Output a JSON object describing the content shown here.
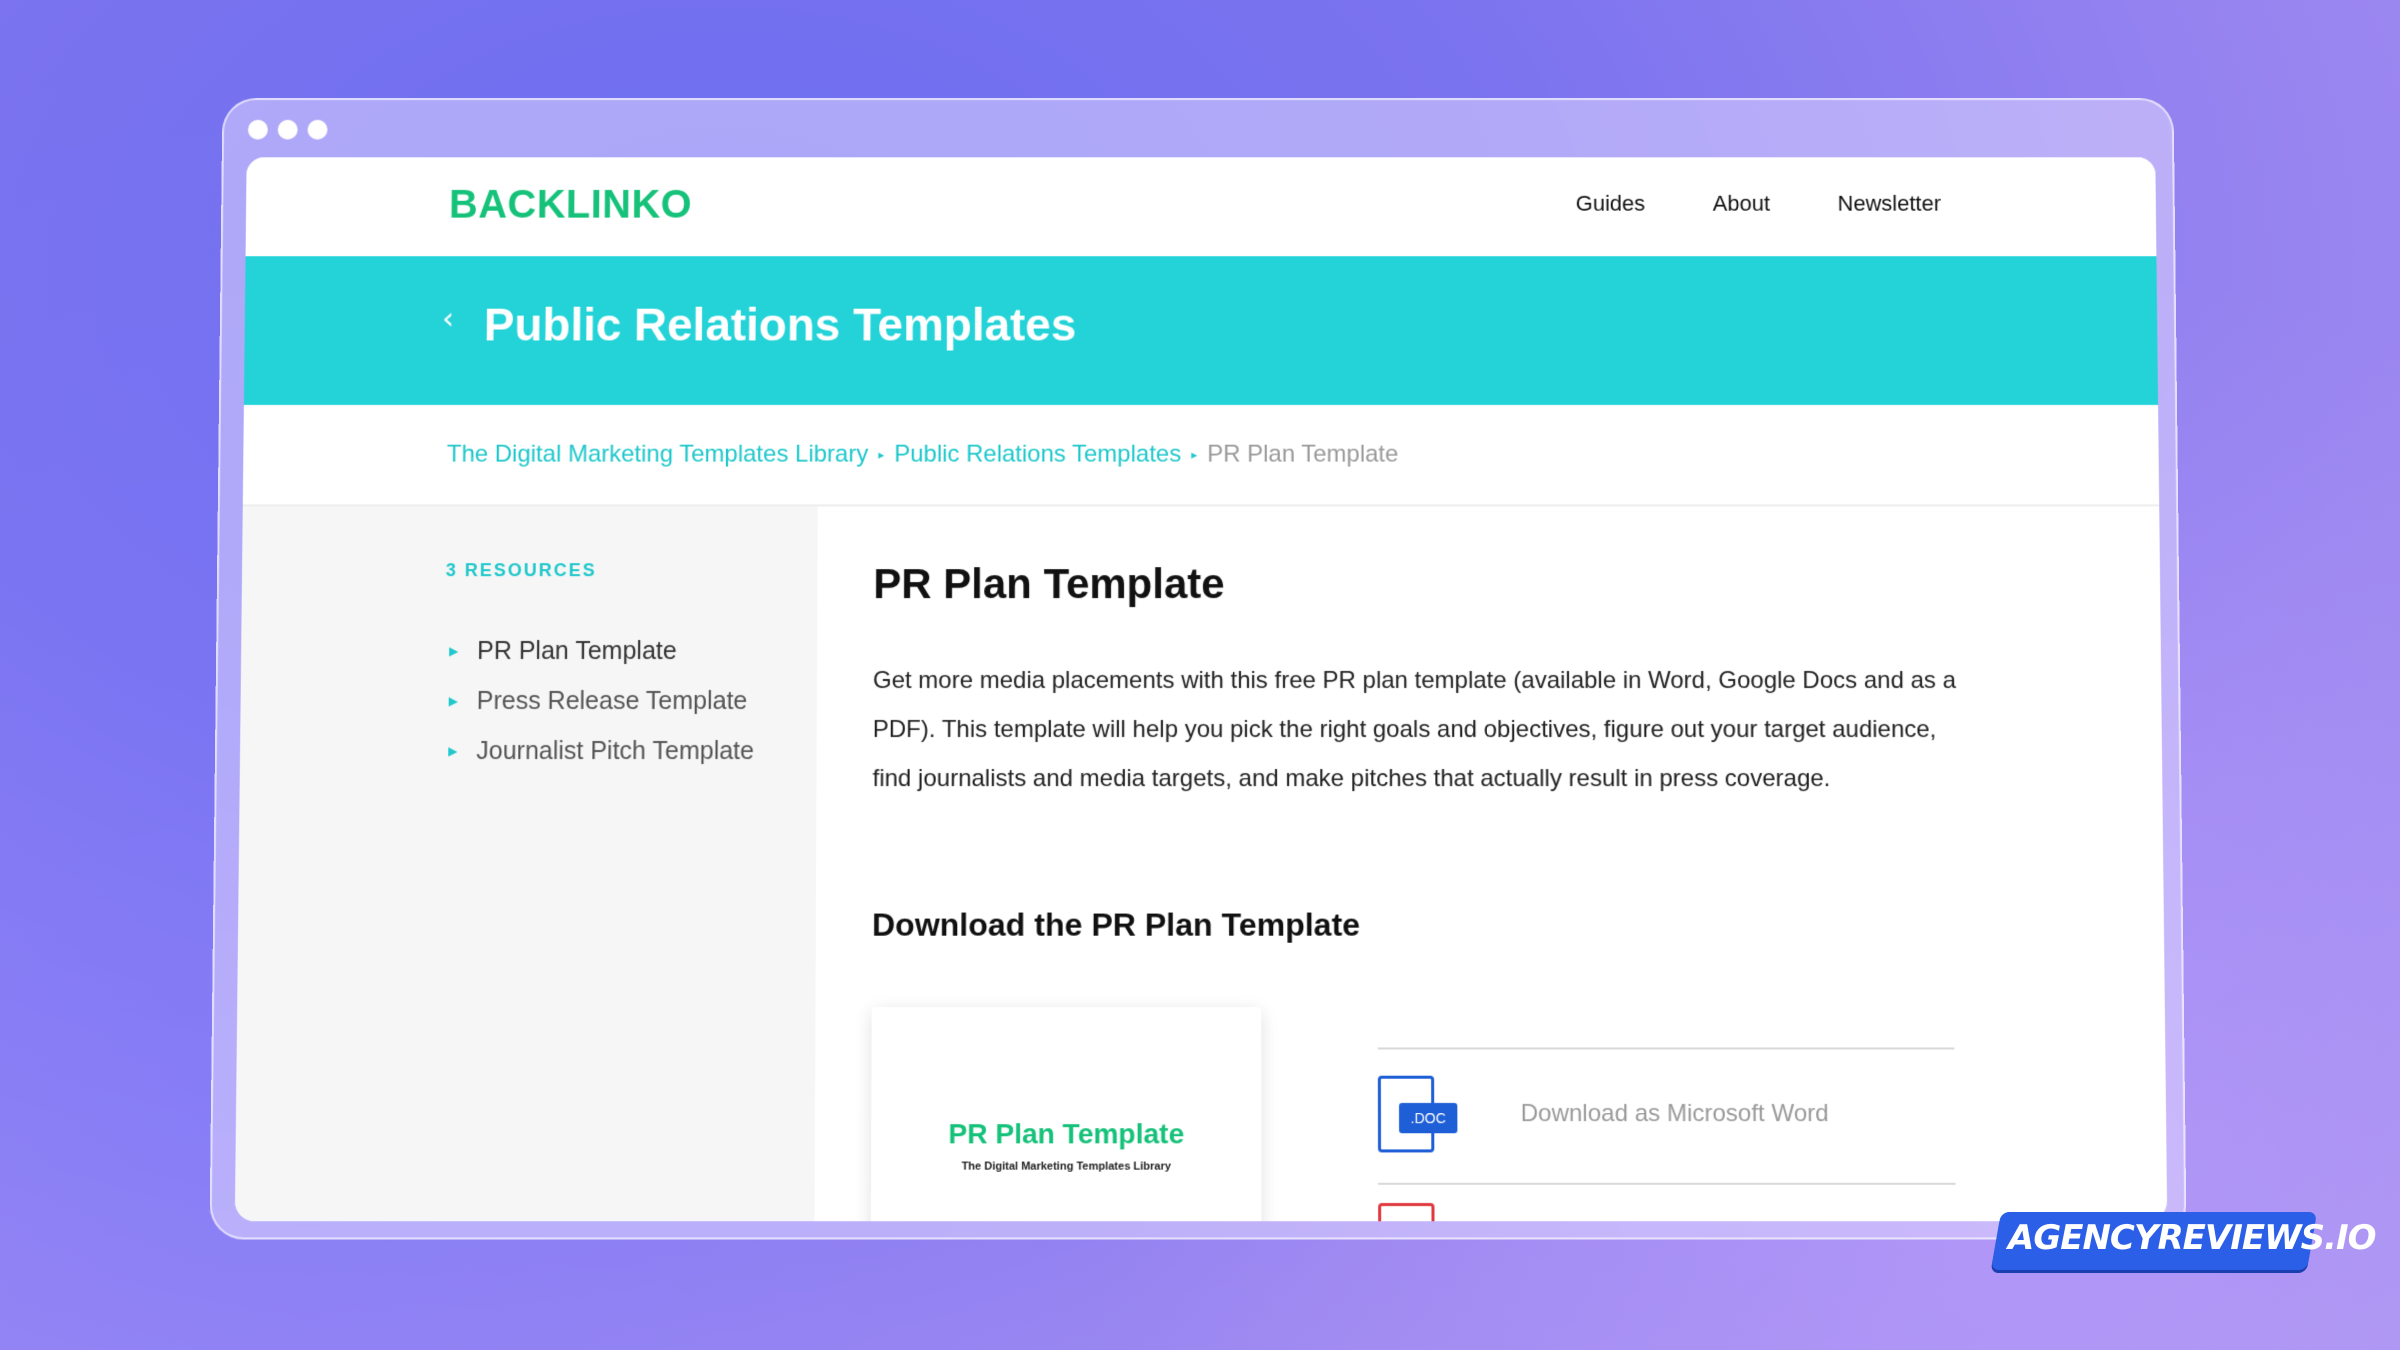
{
  "header": {
    "logo": "BACKLINKO",
    "nav": [
      "Guides",
      "About",
      "Newsletter"
    ]
  },
  "banner": {
    "back_icon": "chevron-left-icon",
    "title": "Public Relations Templates"
  },
  "breadcrumb": {
    "items": [
      "The Digital Marketing Templates Library",
      "Public Relations Templates"
    ],
    "current": "PR Plan Template"
  },
  "sidebar": {
    "count_label": "3 RESOURCES",
    "items": [
      {
        "label": "PR Plan Template",
        "active": true
      },
      {
        "label": "Press Release Template",
        "active": false
      },
      {
        "label": "Journalist Pitch Template",
        "active": false
      }
    ]
  },
  "main": {
    "title": "PR Plan Template",
    "description": "Get more media placements with this free PR plan template (available in Word, Google Docs and as a PDF). This template will help you pick the right goals and objectives, figure out your target audience, find journalists and media targets, and make pitches that actually result in press coverage.",
    "download_heading": "Download the PR Plan Template",
    "preview": {
      "title": "PR Plan Template",
      "subtitle": "The Digital Marketing Templates Library"
    },
    "downloads": [
      {
        "badge": ".DOC",
        "label": "Download as Microsoft Word",
        "icon": "doc-file-icon"
      }
    ]
  },
  "watermark": "AGENCYREVIEWS.IO",
  "colors": {
    "brand_green": "#16c27a",
    "banner_teal": "#24d3d8",
    "link_teal": "#1fc8cc",
    "doc_blue": "#1e5ed6",
    "pdf_red": "#e0383e",
    "watermark_blue": "#2c5fe8"
  }
}
